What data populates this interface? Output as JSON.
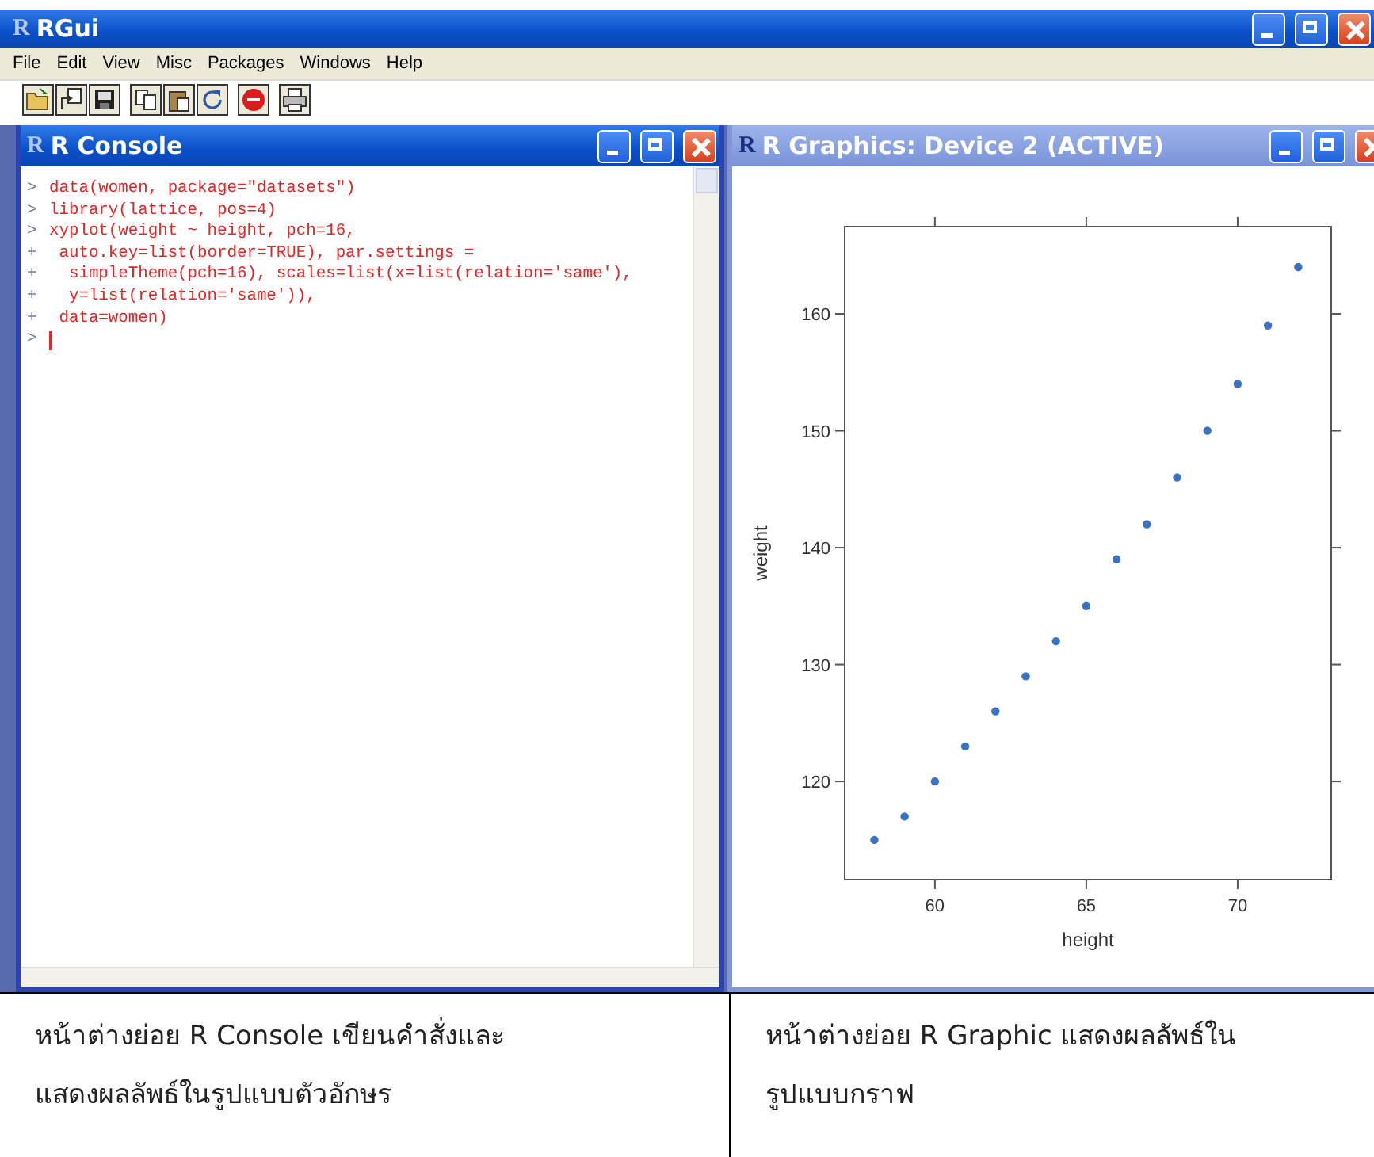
{
  "window": {
    "logo": "R",
    "title": "RGui"
  },
  "menu": [
    "File",
    "Edit",
    "View",
    "Misc",
    "Packages",
    "Windows",
    "Help"
  ],
  "toolbar": [
    {
      "kind": "open"
    },
    {
      "kind": "load"
    },
    {
      "kind": "save"
    },
    {
      "kind": "copy"
    },
    {
      "kind": "paste"
    },
    {
      "kind": "refresh"
    },
    {
      "kind": "stop"
    },
    {
      "kind": "print"
    }
  ],
  "console": {
    "logo": "R",
    "title": "R Console",
    "lines": [
      {
        "prompt": ">",
        "code": "data(women, package=\"datasets\")"
      },
      {
        "prompt": ">",
        "code": "library(lattice, pos=4)"
      },
      {
        "prompt": ">",
        "code": "xyplot(weight ~ height, pch=16,"
      },
      {
        "prompt": "+",
        "code": " auto.key=list(border=TRUE), par.settings ="
      },
      {
        "prompt": "+",
        "code": "  simpleTheme(pch=16), scales=list(x=list(relation='same'),"
      },
      {
        "prompt": "+",
        "code": "  y=list(relation='same')),"
      },
      {
        "prompt": "+",
        "code": " data=women)"
      }
    ],
    "input_prompt": ">"
  },
  "graphics": {
    "logo": "R",
    "title": "R Graphics: Device 2 (ACTIVE)",
    "chart_data": {
      "type": "scatter",
      "xlabel": "height",
      "ylabel": "weight",
      "x": [
        58,
        59,
        60,
        61,
        62,
        63,
        64,
        65,
        66,
        67,
        68,
        69,
        70,
        71,
        72
      ],
      "series": [
        {
          "color": "#3a72c4",
          "values": [
            115,
            117,
            120,
            123,
            126,
            129,
            132,
            135,
            139,
            142,
            146,
            150,
            154,
            159,
            164
          ]
        }
      ],
      "xlim": [
        57.02,
        73.09
      ],
      "ylim": [
        111.6,
        167.46
      ],
      "xticks": [
        60,
        65,
        70
      ],
      "yticks": [
        120,
        130,
        140,
        150,
        160
      ]
    }
  },
  "captions": [
    {
      "lines": [
        "หน้าต่างย่อย R Console เขียนคำสั่งและ",
        "แสดงผลลัพธ์ในรูปแบบตัวอักษร"
      ]
    },
    {
      "lines": [
        "หน้าต่างย่อย R Graphic แสดงผลลัพธ์ใน",
        "รูปแบบกราฟ"
      ]
    }
  ]
}
